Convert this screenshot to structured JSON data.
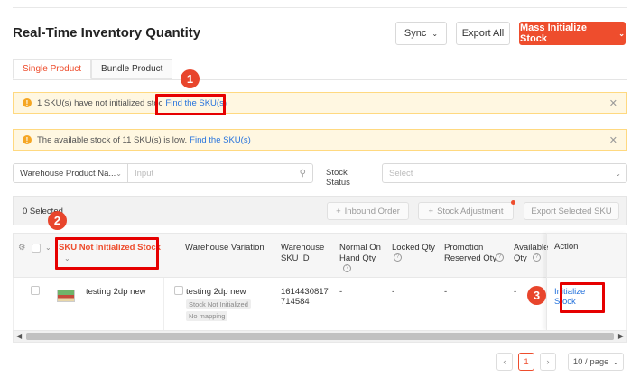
{
  "header": {
    "title": "Real-Time Inventory Quantity",
    "sync_label": "Sync",
    "export_all_label": "Export All",
    "mass_init_label": "Mass Initialize Stock"
  },
  "tabs": [
    {
      "label": "Single Product",
      "active": true
    },
    {
      "label": "Bundle Product",
      "active": false
    }
  ],
  "banners": [
    {
      "text": "1 SKU(s) have not initialized stoc",
      "link": "Find the SKU(s)"
    },
    {
      "text": "The available stock of 11 SKU(s) is low.",
      "link": "Find the SKU(s)"
    }
  ],
  "filters": {
    "warehouse_select": "Warehouse Product Na...",
    "search_placeholder": "Input",
    "stock_status_label": "Stock Status",
    "stock_status_placeholder": "Select"
  },
  "toolbar": {
    "selected_count": "0 Selected",
    "inbound_label": "Inbound Order",
    "adjust_label": "Stock Adjustment",
    "export_selected_label": "Export Selected SKU"
  },
  "table": {
    "columns": {
      "sku_filter": "SKU Not Initialized Stock",
      "warehouse_variation": "Warehouse Variation",
      "warehouse_sku_id": "Warehouse SKU ID",
      "normal_on_hand": "Normal On Hand Qty",
      "locked_qty": "Locked Qty",
      "promotion_reserved": "Promotion Reserved Qty",
      "available_qty": "Available Qty",
      "action": "Action"
    },
    "rows": [
      {
        "product_name": "testing 2dp new",
        "variation_name": "testing 2dp new",
        "badge_status": "Stock Not Initialized",
        "badge_mapping": "No mapping",
        "sku_id": "1614430817714584",
        "sku_id_line1": "1614430817",
        "sku_id_line2": "714584",
        "normal_on_hand": "-",
        "locked": "-",
        "promotion_reserved": "-",
        "available": "-",
        "action_line1": "Initialize",
        "action_line2": "Stock"
      }
    ]
  },
  "pagination": {
    "current_page": "1",
    "page_size": "10 / page"
  },
  "annotations": [
    "1",
    "2",
    "3"
  ],
  "colors": {
    "brand": "#ee4d2d",
    "link": "#2673dd",
    "highlight": "#e60000",
    "banner_bg": "#fff7e1"
  }
}
